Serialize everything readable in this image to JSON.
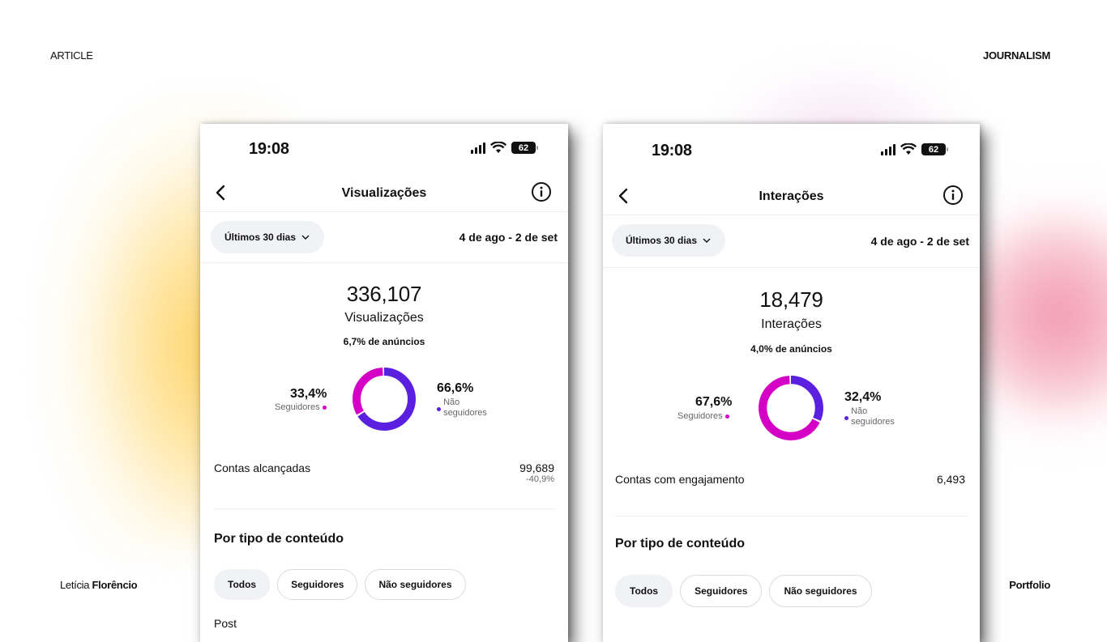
{
  "corners": {
    "top_left": "ARTICLE",
    "top_right": "JOURNALISM",
    "author_first": "Letícia",
    "author_last": "Florêncio",
    "bottom_right": "Portfolio"
  },
  "colors": {
    "followers": "#d400c6",
    "non_followers": "#5b1fe0"
  },
  "phones": [
    {
      "status": {
        "time": "19:08",
        "battery": "62"
      },
      "title": "Visualizações",
      "range_label": "Últimos 30 dias",
      "range_dates": "4 de ago - 2 de set",
      "total": "336,107",
      "total_label": "Visualizações",
      "ads_note": "6,7% de anúncios",
      "followers_pct": "33,4%",
      "followers_label": "Seguidores",
      "followers_fraction": 0.334,
      "non_followers_pct": "66,6%",
      "non_followers_label_1": "Não",
      "non_followers_label_2": "seguidores",
      "metric_label": "Contas alcançadas",
      "metric_value": "99,689",
      "metric_delta": "-40,9%",
      "section_title": "Por tipo de conteúdo",
      "chips": [
        "Todos",
        "Seguidores",
        "Não seguidores"
      ],
      "peek": "Post"
    },
    {
      "status": {
        "time": "19:08",
        "battery": "62"
      },
      "title": "Interações",
      "range_label": "Últimos 30 dias",
      "range_dates": "4 de ago - 2 de set",
      "total": "18,479",
      "total_label": "Interações",
      "ads_note": "4,0% de anúncios",
      "followers_pct": "67,6%",
      "followers_label": "Seguidores",
      "followers_fraction": 0.676,
      "non_followers_pct": "32,4%",
      "non_followers_label_1": "Não",
      "non_followers_label_2": "seguidores",
      "metric_label": "Contas com engajamento",
      "metric_value": "6,493",
      "section_title": "Por tipo de conteúdo",
      "chips": [
        "Todos",
        "Seguidores",
        "Não seguidores"
      ]
    }
  ]
}
